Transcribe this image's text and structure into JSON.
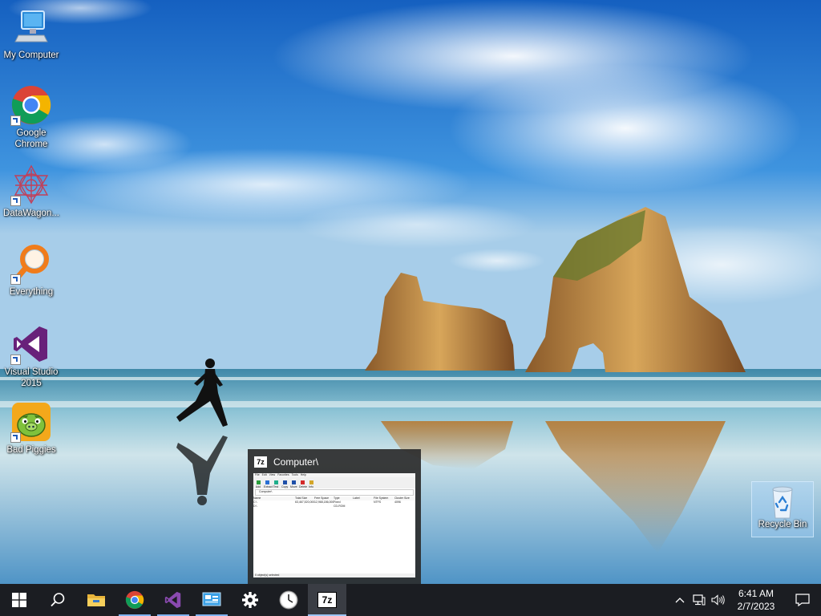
{
  "desktop": {
    "icons": [
      {
        "label": "My Computer",
        "icon": "computer-icon"
      },
      {
        "label": "Google Chrome",
        "icon": "chrome-icon"
      },
      {
        "label": "DataWagon...",
        "icon": "datawagon-icon"
      },
      {
        "label": "Everything",
        "icon": "everything-search-icon"
      },
      {
        "label": "Visual Studio 2015",
        "icon": "visual-studio-icon"
      },
      {
        "label": "Bad Piggies",
        "icon": "bad-piggies-icon"
      }
    ],
    "recycle_bin": {
      "label": "Recycle Bin",
      "icon": "recycle-bin-icon"
    }
  },
  "thumbnail": {
    "title": "Computer\\",
    "app_badge": "7z",
    "window": {
      "menu": [
        "File",
        "Edit",
        "View",
        "Favorites",
        "Tools",
        "Help"
      ],
      "toolbar": [
        "Add",
        "Extract",
        "Test",
        "Copy",
        "Move",
        "Delete",
        "Info"
      ],
      "address": "Computer\\",
      "columns": [
        "Name",
        "Total Size",
        "Free Space",
        "Type",
        "Label",
        "File System",
        "Cluster Size"
      ],
      "rows": [
        {
          "name": "C:\\",
          "total": "63,467,520,000",
          "free": "12,968,186,000",
          "type": "Fixed",
          "label": "",
          "fs": "NTFS",
          "cluster": "4096"
        },
        {
          "name": "D:\\",
          "total": "",
          "free": "",
          "type": "CD-ROM",
          "label": "",
          "fs": "",
          "cluster": ""
        }
      ],
      "status": "0 object(s) selected"
    }
  },
  "taskbar": {
    "buttons": [
      {
        "name": "start-button",
        "icon": "windows-logo-icon"
      },
      {
        "name": "search-button",
        "icon": "search-icon"
      },
      {
        "name": "file-explorer-button",
        "icon": "folder-icon"
      },
      {
        "name": "chrome-button",
        "icon": "chrome-icon"
      },
      {
        "name": "visual-studio-button",
        "icon": "visual-studio-icon"
      },
      {
        "name": "control-panel-button",
        "icon": "control-panel-icon"
      },
      {
        "name": "settings-button",
        "icon": "gear-icon"
      },
      {
        "name": "clock-app-button",
        "icon": "clock-icon"
      },
      {
        "name": "7zip-button",
        "icon": "7zip-icon",
        "badge": "7z"
      }
    ],
    "tray": {
      "time": "6:41 AM",
      "date": "2/7/2023",
      "icons": [
        "chevron-up-icon",
        "network-icon",
        "volume-icon"
      ],
      "notification_icon": "action-center-icon"
    }
  },
  "colors": {
    "taskbar": "#1b1d22",
    "accent": "#7fb2f0",
    "vs_purple": "#68217a",
    "everything_orange": "#f07c1b"
  }
}
